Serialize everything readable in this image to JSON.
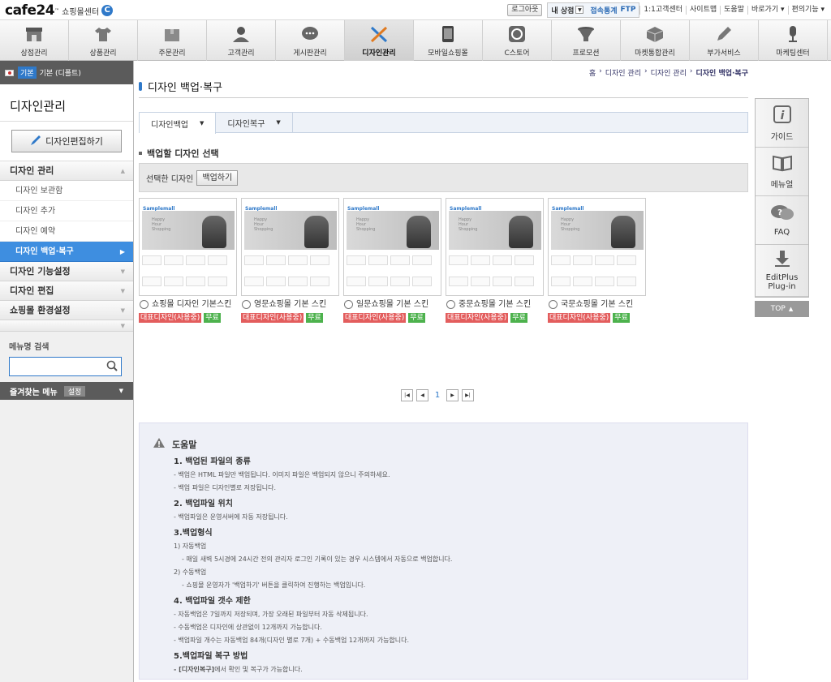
{
  "top": {
    "logo_word": "cafe24",
    "logo_tm": "™",
    "logo_sub": "쇼핑몰센터",
    "logout": "로그아웃",
    "shop_label": "내 상점",
    "stats": "접속통계",
    "ftp": "FTP",
    "links": [
      "1:1고객센터",
      "사이트맵",
      "도움말",
      "바로가기 ▾",
      "편의기능 ▾"
    ]
  },
  "gnb": [
    "상점관리",
    "상품관리",
    "주문관리",
    "고객관리",
    "게시판관리",
    "디자인관리",
    "모바일쇼핑몰",
    "C스토어",
    "프로모션",
    "마켓통합관리",
    "부가서비스",
    "마케팅센터"
  ],
  "lnb": {
    "lang_badge": "기본",
    "lang_text": "기본 (디폴트)",
    "title": "디자인관리",
    "edit_btn": "디자인편집하기",
    "sections": [
      {
        "label": "디자인 관리",
        "sub": [
          "디자인 보관함",
          "디자인 추가",
          "디자인 예약",
          "디자인 백업·복구"
        ]
      },
      {
        "label": "디자인 기능설정"
      },
      {
        "label": "디자인 편집"
      },
      {
        "label": "쇼핑몰 환경설정"
      }
    ],
    "search_label": "메뉴명 검색",
    "fav_label": "즐겨찾는 메뉴",
    "fav_set": "설정"
  },
  "breadcrumb": [
    "홈",
    "디자인 관리",
    "디자인 관리",
    "디자인 백업·복구"
  ],
  "page_title": "디자인 백업·복구",
  "tabs": [
    "디자인백업",
    "디자인복구"
  ],
  "section_title": "백업할 디자인 선택",
  "selected_label": "선택한 디자인",
  "backup_btn": "백업하기",
  "skins": [
    {
      "name": "쇼핑몰 디자인 기본스킨",
      "tag": "대표디자인(사용중)",
      "free": "무료"
    },
    {
      "name": "영문쇼핑몰 기본 스킨",
      "tag": "대표디자인(사용중)",
      "free": "무료"
    },
    {
      "name": "일문쇼핑몰 기본 스킨",
      "tag": "대표디자인(사용중)",
      "free": "무료"
    },
    {
      "name": "중문쇼핑몰 기본 스킨",
      "tag": "대표디자인(사용중)",
      "free": "무료"
    },
    {
      "name": "국문쇼핑몰 기본 스킨",
      "tag": "대표디자인(사용중)",
      "free": "무료"
    }
  ],
  "thumb_logo": "Samplemall",
  "thumb_hero": "Happy\nHour\nShopping",
  "page_num": "1",
  "help": {
    "title": "도움말",
    "h1": "1. 백업된 파일의 종류",
    "p1a": "- 백업은 HTML 파일만 백업됩니다. 이미지 파일은 백업되지 않으니 주의하세요.",
    "p1b": "- 백업 파일은 디자인별로 저장됩니다.",
    "h2": "2. 백업파일 위치",
    "p2a": "- 백업파일은 운영서버에 자동 저장됩니다.",
    "h3": "3.백업형식",
    "p3a": "1) 자동백업",
    "p3b": "- 매일 새벽 5시경에 24시간 전의 관리자 로그인 기록이 있는 경우 시스템에서 자동으로 백업합니다.",
    "p3c": "2) 수동백업",
    "p3d": "- 쇼핑몰 운영자가 '백업하기' 버튼을 클릭하여 진행하는 백업입니다.",
    "h4": "4. 백업파일 갯수 제한",
    "p4a": "- 자동백업은 7일까지 저장되며, 가장 오래된 파일부터 자동 삭제됩니다.",
    "p4b": "- 수동백업은 디자인에 상관없이 12개까지 가능합니다.",
    "p4c": "- 백업파일 개수는 자동백업 84개(디자인 별로 7개) + 수동백업 12개까지 가능합니다.",
    "h5": "5.백업파일 복구 방법",
    "p5a_bold": "- [디자인복구]",
    "p5a": "에서 확인 및 복구가 가능합니다."
  },
  "side": [
    "가이드",
    "메뉴얼",
    "FAQ",
    "EditPlus\nPlug-in"
  ],
  "top_btn": "TOP"
}
